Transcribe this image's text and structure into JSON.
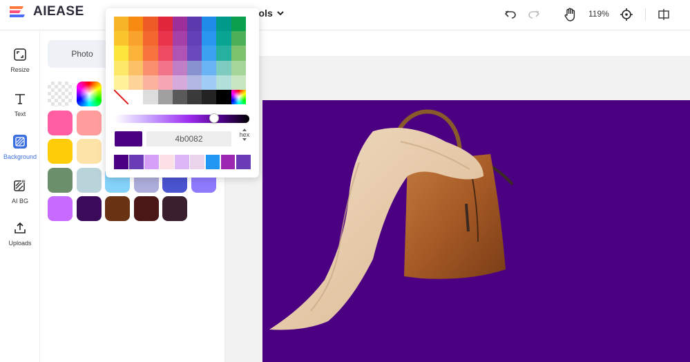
{
  "app": {
    "logo_text": "AIEASE",
    "tools_menu_label": "ools",
    "zoom_level": "119%"
  },
  "toolbar_icons": {
    "undo": "undo-icon",
    "redo": "redo-icon",
    "pan": "hand-icon",
    "fit": "crosshair-icon",
    "compare": "compare-icon"
  },
  "leftnav": {
    "items": [
      {
        "label": "Resize",
        "icon": "resize-icon"
      },
      {
        "label": "Text",
        "icon": "text-icon"
      },
      {
        "label": "Background",
        "icon": "background-icon",
        "active": true
      },
      {
        "label": "AI BG",
        "icon": "ai-bg-icon"
      },
      {
        "label": "Uploads",
        "icon": "upload-icon"
      }
    ]
  },
  "panel": {
    "photo_tab_label": "Photo",
    "swatch_rows": [
      [
        "transparent",
        "gradient",
        "",
        "",
        "",
        ""
      ],
      [
        "#ff5fa2",
        "#ff9d9d",
        "",
        "",
        "",
        ""
      ],
      [
        "#ffcc0a",
        "#fde3a7",
        "",
        "",
        "",
        ""
      ],
      [
        "#6a8f6a",
        "#b8d3d9",
        "#85d3fb",
        "#aeaedc",
        "#4b54d1",
        "#8f7bff"
      ],
      [
        "#c76bff",
        "#3b0a5a",
        "#6a3414",
        "#4a1616",
        "#3a1f2f",
        ""
      ]
    ]
  },
  "picker": {
    "grid_colors": [
      [
        "#f9b52a",
        "#f78b12",
        "#ee5b26",
        "#e0273c",
        "#9c2f9a",
        "#5b3aad",
        "#1f8ce8",
        "#00998a",
        "#0aa04d"
      ],
      [
        "#fbc62d",
        "#f9a32c",
        "#f4672f",
        "#e9344c",
        "#a640a9",
        "#6440b8",
        "#2b96ef",
        "#0aa592",
        "#4daf57"
      ],
      [
        "#fde53b",
        "#fbb33a",
        "#f7733d",
        "#ee4a63",
        "#af54b4",
        "#6a49bd",
        "#3da1f2",
        "#26b09f",
        "#7dc26d"
      ],
      [
        "#fde869",
        "#fcc166",
        "#f98f6e",
        "#f1748a",
        "#c07ec6",
        "#8892d0",
        "#6ab4f5",
        "#7ecbbf",
        "#a6d59a"
      ],
      [
        "#fef399",
        "#fed49b",
        "#fbb39e",
        "#f6a5b5",
        "#d6aadb",
        "#b3b8e2",
        "#9fcdf7",
        "#b2dfd9",
        "#c8e6bf"
      ],
      [
        "none",
        "#ffffff",
        "#dddddd",
        "#a0a0a0",
        "#5a5a5a",
        "#3a3a3a",
        "#232323",
        "#000000",
        "spectrum"
      ]
    ],
    "slider_position": 0.74,
    "current_color": "#4b0082",
    "hex_value": "4b0082",
    "mode_label": "hex",
    "recent_colors": [
      "#4b0082",
      "#6a3bb6",
      "#d6a0f8",
      "#fde0e6",
      "#dcb6f6",
      "#ead4ec",
      "#2196f3",
      "#9c27b0",
      "#6a3bb6"
    ]
  },
  "canvas": {
    "background_color": "#4b0082"
  }
}
